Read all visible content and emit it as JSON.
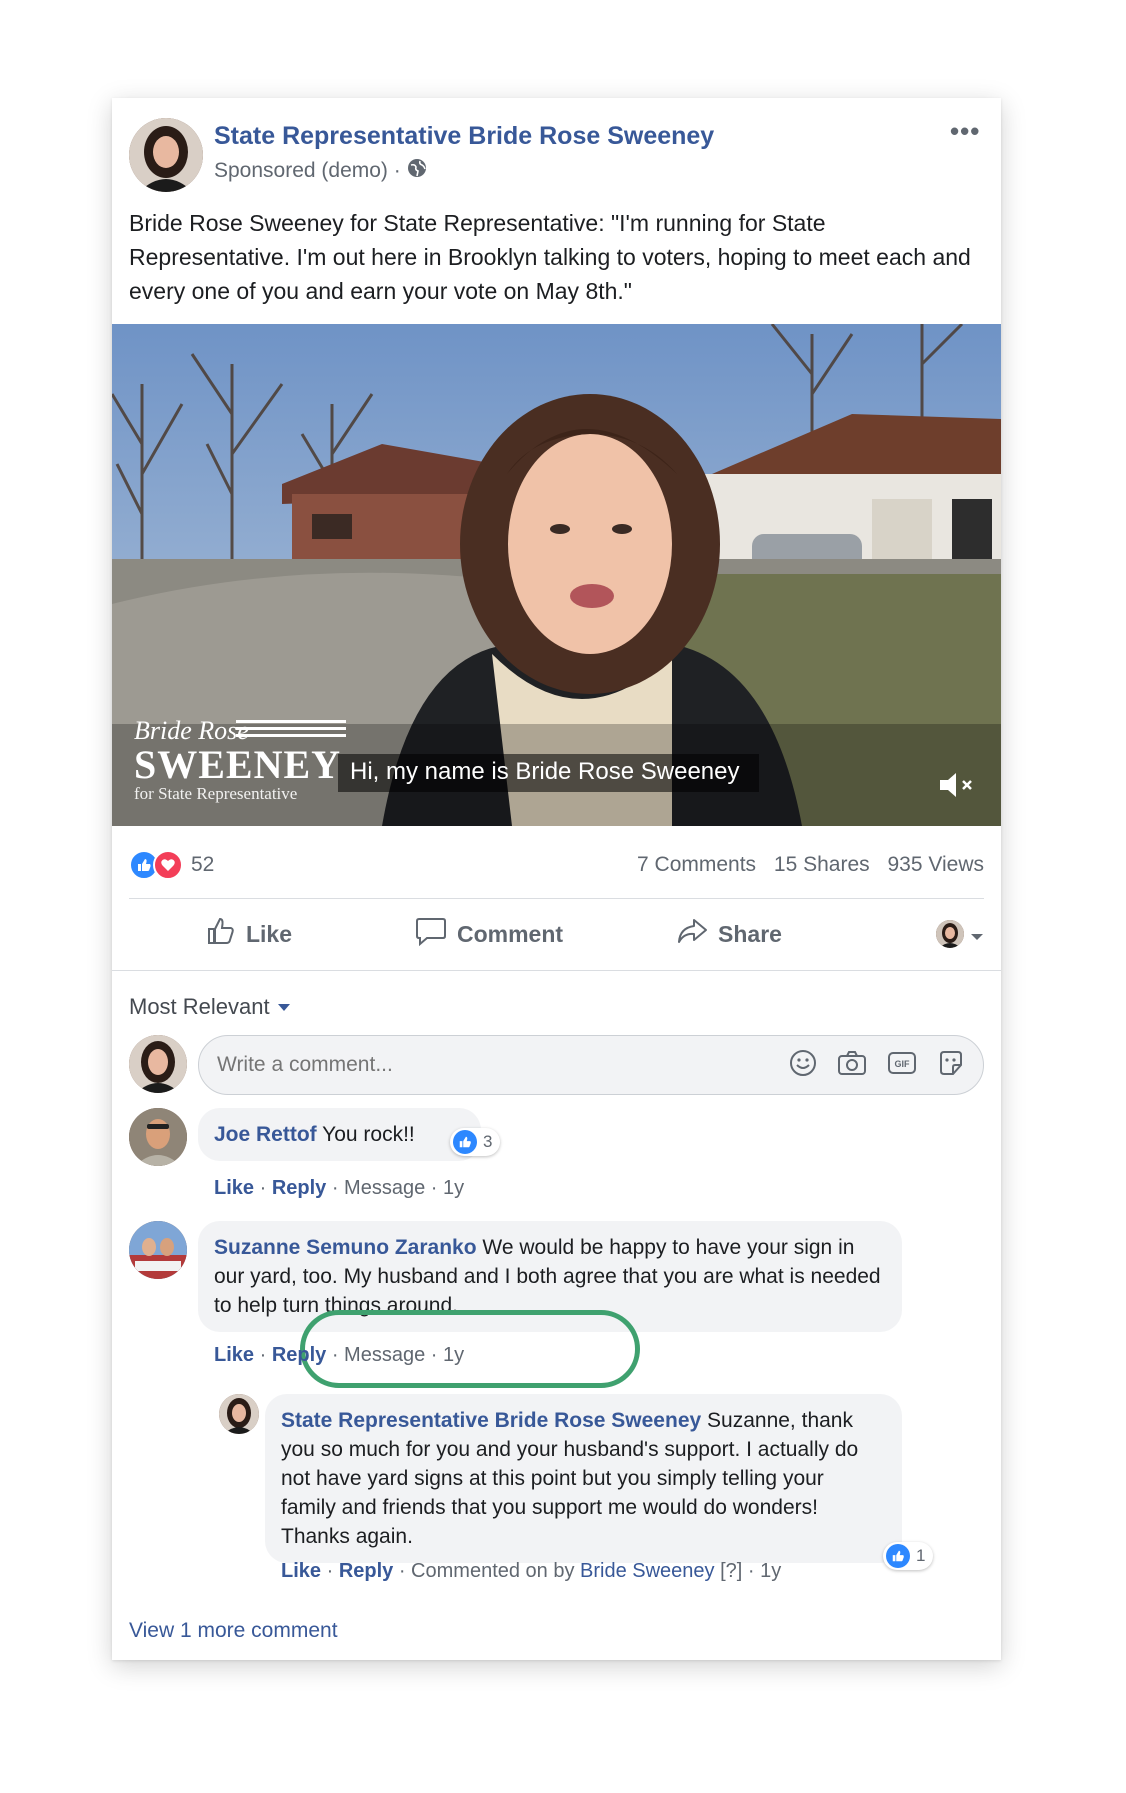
{
  "post": {
    "page_name": "State Representative Bride Rose Sweeney",
    "sponsored_label": "Sponsored (demo) ·",
    "text": "Bride Rose Sweeney for State Representative: \"I'm running for State Representative. I'm out here in Brooklyn talking to voters, hoping to meet each and every one of you and earn your vote on May 8th.\""
  },
  "video": {
    "logo_script": "Bride Rose",
    "logo_name": "SWEENEY",
    "logo_sub": "for State Representative",
    "caption": "Hi, my name is Bride Rose Sweeney"
  },
  "stats": {
    "reaction_count": "52",
    "comments": "7 Comments",
    "shares": "15 Shares",
    "views": "935 Views"
  },
  "actions": {
    "like": "Like",
    "comment": "Comment",
    "share": "Share"
  },
  "sort_label": "Most Relevant",
  "composer": {
    "placeholder": "Write a comment..."
  },
  "comments": [
    {
      "author": "Joe Rettof",
      "text": "You rock!!",
      "likes": "3",
      "like_label": "Like",
      "reply_label": "Reply",
      "meta": " · Message · 1y"
    },
    {
      "author": "Suzanne Semuno Zaranko",
      "text": "We would be happy to have your sign in our yard, too. My husband and I both agree that you are what is needed to help turn things around.",
      "like_label": "Like",
      "reply_label": "Reply",
      "meta": " · Message · 1y"
    }
  ],
  "reply": {
    "author": "State Representative Bride Rose Sweeney",
    "text": "Suzanne, thank you so much for you and your husband's support. I actually do not have yard signs at this point but you simply telling your family and friends that you support me would do wonders! Thanks again.",
    "likes": "1",
    "like_label": "Like",
    "reply_label": "Reply",
    "commented_by": " · Commented on by ",
    "commented_by_name": "Bride Sweeney",
    "meta_tail": " [?] · 1y"
  },
  "view_more": "View 1 more comment",
  "colors": {
    "link_blue": "#385898",
    "like_blue": "#2d88ff",
    "love_red": "#f33e58",
    "highlight_green": "#3fa16f"
  }
}
